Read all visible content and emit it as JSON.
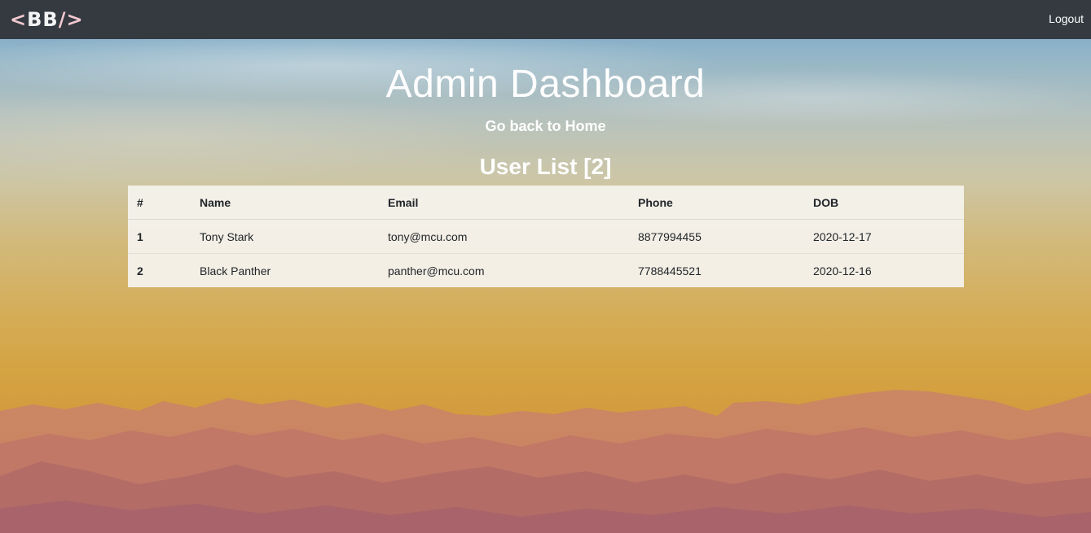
{
  "navbar": {
    "brand_open": "<",
    "brand_text": "BB",
    "brand_close": "/>",
    "logout_label": "Logout"
  },
  "page": {
    "title": "Admin Dashboard",
    "home_link": "Go back to Home",
    "list_title": "User List [2]"
  },
  "table": {
    "headers": [
      "#",
      "Name",
      "Email",
      "Phone",
      "DOB"
    ],
    "rows": [
      {
        "idx": "1",
        "name": "Tony Stark",
        "email": "tony@mcu.com",
        "phone": "8877994455",
        "dob": "2020-12-17"
      },
      {
        "idx": "2",
        "name": "Black Panther",
        "email": "panther@mcu.com",
        "phone": "7788445521",
        "dob": "2020-12-16"
      }
    ]
  },
  "colors": {
    "navbar_bg": "#343a40",
    "text_on_bg": "#ffffff",
    "table_bg": "#f5f3ee"
  }
}
